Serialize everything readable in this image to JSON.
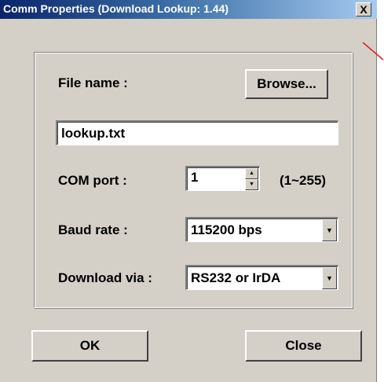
{
  "window": {
    "title": "Comm Properties (Download Lookup: 1.44)",
    "close_glyph": "X"
  },
  "form": {
    "file_name_label": "File name :",
    "browse_label": "Browse...",
    "file_name_value": "lookup.txt",
    "com_port_label": "COM port :",
    "com_port_value": "1",
    "com_port_range": "(1~255)",
    "baud_rate_label": "Baud rate :",
    "baud_rate_value": "115200 bps",
    "download_via_label": "Download via :",
    "download_via_value": "RS232 or IrDA"
  },
  "buttons": {
    "ok_label": "OK",
    "close_label": "Close"
  },
  "icons": {
    "spin_up": "▲",
    "spin_down": "▼",
    "dropdown": "▼"
  },
  "colors": {
    "titlebar_start": "#0a246a",
    "titlebar_end": "#a6caf0",
    "face": "#d4d0c8"
  }
}
